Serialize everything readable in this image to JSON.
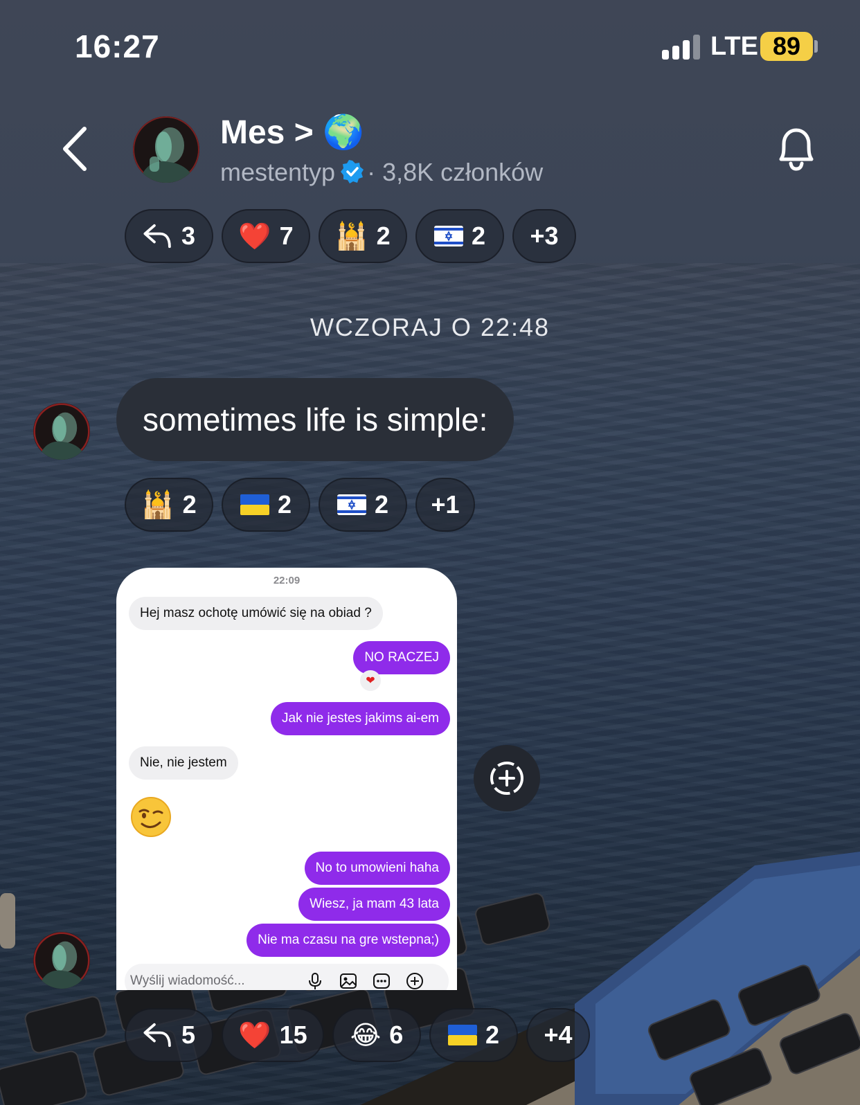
{
  "status_bar": {
    "time": "16:27",
    "network": "LTE",
    "battery": "89"
  },
  "header": {
    "title": "Mes > 🌍",
    "handle": "mestentyp",
    "members": "· 3,8K członków"
  },
  "top_reactions": [
    {
      "icon": "reply-icon",
      "count": "3"
    },
    {
      "emoji": "❤️",
      "count": "7"
    },
    {
      "emoji": "🕌",
      "count": "2"
    },
    {
      "emoji": "🇮🇱",
      "count": "2"
    },
    {
      "more": "+3"
    }
  ],
  "date_separator": "WCZORAJ O 22:48",
  "message": {
    "text": "sometimes life is simple:"
  },
  "message_reactions": [
    {
      "emoji": "🕌",
      "count": "2"
    },
    {
      "emoji": "🇺🇦",
      "count": "2"
    },
    {
      "emoji": "🇮🇱",
      "count": "2"
    },
    {
      "more": "+1"
    }
  ],
  "screenshot": {
    "time": "22:09",
    "messages": [
      {
        "dir": "in",
        "text": "Hej  masz ochotę umówić się na obiad ?"
      },
      {
        "dir": "out",
        "text": "NO RACZEJ",
        "reaction": "❤"
      },
      {
        "dir": "out",
        "text": "Jak nie jestes jakims ai-em"
      },
      {
        "dir": "in",
        "text": "Nie, nie jestem"
      },
      {
        "dir": "in",
        "emoji": "😉"
      },
      {
        "dir": "out",
        "text": "No to umowieni haha"
      },
      {
        "dir": "out",
        "text": "Wiesz, ja mam 43 lata"
      },
      {
        "dir": "out",
        "text": "Nie ma czasu na gre wstepna;)"
      }
    ],
    "composer_placeholder": "Wyślij wiadomość..."
  },
  "bottom_reactions": [
    {
      "icon": "reply-icon",
      "count": "5"
    },
    {
      "emoji": "❤️",
      "count": "15"
    },
    {
      "emoji": "😂",
      "count": "6"
    },
    {
      "emoji": "🇺🇦",
      "count": "2"
    },
    {
      "more": "+4"
    }
  ],
  "colors": {
    "bubble_out": "#8f2bea",
    "battery": "#f5cf46",
    "verified": "#1d9bf0"
  }
}
